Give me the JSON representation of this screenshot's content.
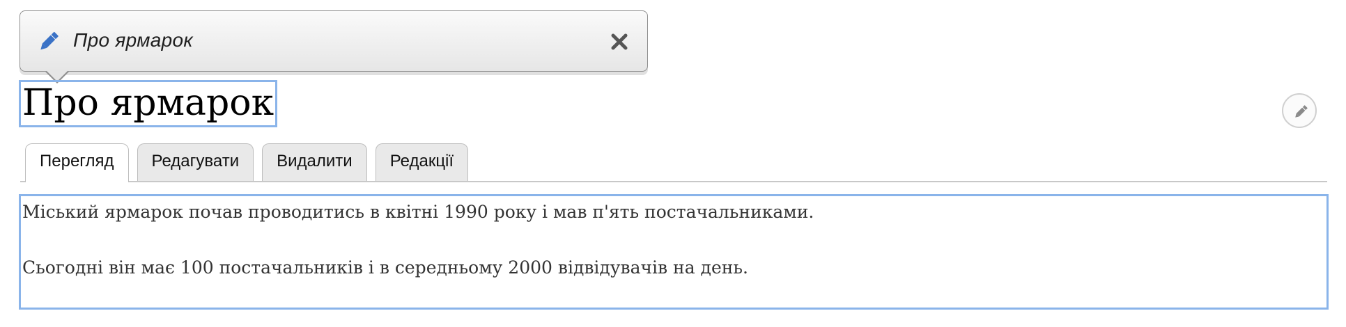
{
  "tooltip": {
    "title": "Про ярмарок",
    "icon": "pencil-icon",
    "close_icon": "close-icon"
  },
  "page": {
    "title": "Про ярмарок",
    "edit_icon": "pencil-icon"
  },
  "tabs": [
    {
      "label": "Перегляд",
      "active": true
    },
    {
      "label": "Редагувати",
      "active": false
    },
    {
      "label": "Видалити",
      "active": false
    },
    {
      "label": "Редакції",
      "active": false
    }
  ],
  "body": {
    "paragraphs": [
      "Міський ярмарок почав проводитись в квітні 1990 року і мав п'ять постачальниками.",
      "Сьогодні він має 100 постачальників і в середньому 2000 відвідувачів на день."
    ]
  },
  "colors": {
    "highlight": "#8ab4ea",
    "pencil": "#3a72c6"
  }
}
